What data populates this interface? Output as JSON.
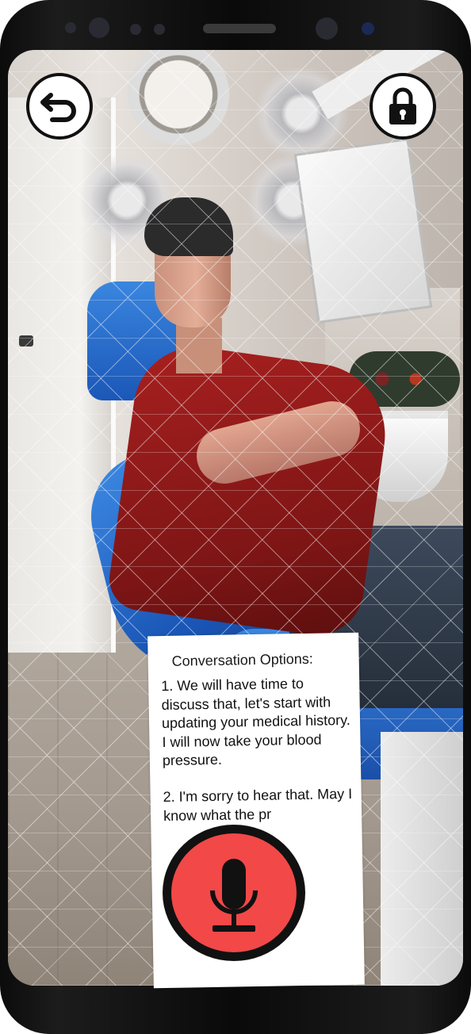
{
  "ar_view": {
    "back_button": {
      "icon": "undo-arrow-icon"
    },
    "lock_button": {
      "icon": "padlock-icon"
    },
    "conversation_panel": {
      "title": "Conversation Options:",
      "options": [
        {
          "text": "1. We will have time to discuss that, let's start with updating your medical history. I will now take your blood pressure."
        },
        {
          "text": "2. I'm sorry to hear that. May I know what the pr"
        }
      ]
    },
    "mic_button": {
      "icon": "microphone-icon",
      "color": "#f24848"
    }
  }
}
